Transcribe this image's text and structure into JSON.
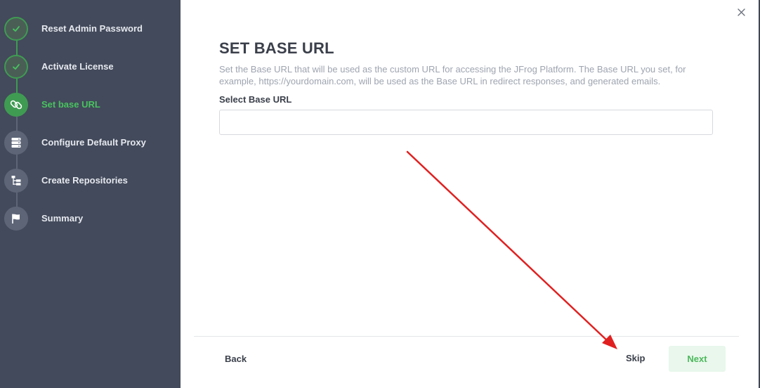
{
  "wizard": {
    "steps": [
      {
        "label": "Reset Admin Password",
        "status": "completed",
        "icon": "check-icon"
      },
      {
        "label": "Activate License",
        "status": "completed",
        "icon": "check-icon"
      },
      {
        "label": "Set base URL",
        "status": "current",
        "icon": "link-icon"
      },
      {
        "label": "Configure Default Proxy",
        "status": "pending",
        "icon": "server-icon"
      },
      {
        "label": "Create Repositories",
        "status": "pending",
        "icon": "repository-tree-icon"
      },
      {
        "label": "Summary",
        "status": "pending",
        "icon": "flag-icon"
      }
    ]
  },
  "main": {
    "title": "SET BASE URL",
    "description": "Set the Base URL that will be used as the custom URL for accessing the JFrog Platform. The Base URL you set, for example, https://yourdomain.com, will be used as the Base URL in redirect responses, and generated emails.",
    "field_label": "Select Base URL",
    "base_url_value": "",
    "base_url_placeholder": ""
  },
  "footer": {
    "back_label": "Back",
    "skip_label": "Skip",
    "next_label": "Next"
  },
  "colors": {
    "sidebar_bg": "#434a5b",
    "accent_green": "#3f9b52",
    "annotation_arrow": "#e02020"
  }
}
